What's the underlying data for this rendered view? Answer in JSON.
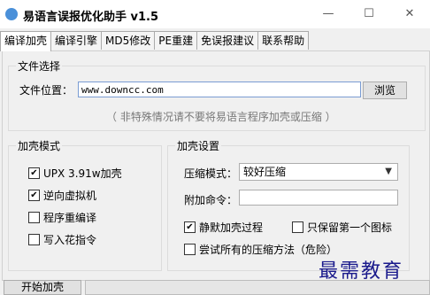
{
  "window": {
    "title": "易语言误报优化助手 v1.5",
    "minimize": "—",
    "maximize": "☐",
    "close": "✕"
  },
  "tabs": [
    {
      "label": "编译加壳",
      "active": true
    },
    {
      "label": "编译引擎"
    },
    {
      "label": "MD5修改"
    },
    {
      "label": "PE重建"
    },
    {
      "label": "免误报建议"
    },
    {
      "label": "联系帮助"
    }
  ],
  "file_group": {
    "title": "文件选择",
    "location_label": "文件位置：",
    "location_value": "www.downcc.com",
    "browse_label": "浏览",
    "hint": "（ 非特殊情况请不要将易语言程序加壳或压缩 ）"
  },
  "shell_mode": {
    "title": "加壳模式",
    "options": [
      {
        "label": "UPX 3.91w加壳",
        "checked": true
      },
      {
        "label": "逆向虚拟机",
        "checked": true
      },
      {
        "label": "程序重编译",
        "checked": false
      },
      {
        "label": "写入花指令",
        "checked": false
      }
    ]
  },
  "shell_settings": {
    "title": "加壳设置",
    "compress_label": "压缩模式：",
    "compress_value": "较好压缩",
    "extra_cmd_label": "附加命令：",
    "extra_cmd_value": "",
    "silent_label": "静默加壳过程",
    "silent_checked": true,
    "keep_icon_label": "只保留第一个图标",
    "keep_icon_checked": false,
    "try_all_label": "尝试所有的压缩方法（危险）",
    "try_all_checked": false
  },
  "start_button": "开始加壳",
  "watermark": "最需教育",
  "check_mark": "✔"
}
